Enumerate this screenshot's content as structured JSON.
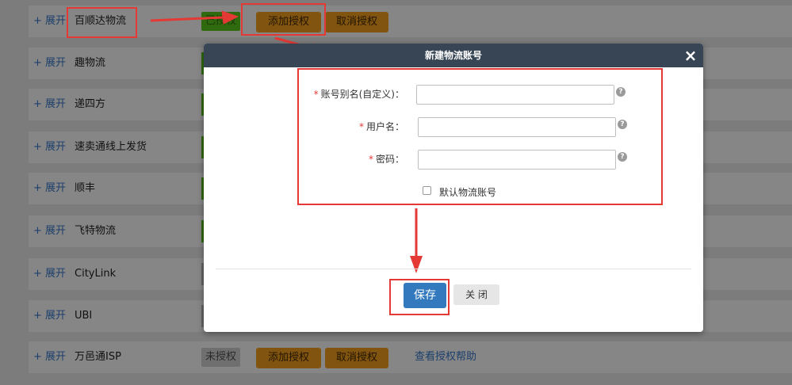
{
  "list": {
    "expand_label": "+ 展开",
    "add_auth_label": "添加授权",
    "cancel_auth_label": "取消授权",
    "help_link": "查看授权帮助",
    "status_authorized": "已授权",
    "status_unauthorized": "未授权",
    "carriers": [
      "百顺达物流",
      "趣物流",
      "递四方",
      "速卖通线上发货",
      "顺丰",
      "飞特物流",
      "CityLink",
      "UBI",
      "万邑通ISP"
    ]
  },
  "modal": {
    "title": "新建物流账号",
    "close_icon": "×",
    "required_mark": "*",
    "alias_label": "账号别名(自定义)：",
    "alias_value": "",
    "username_label": "用户名：",
    "username_value": "",
    "password_label": "密码：",
    "password_value": "",
    "help_icon": "?",
    "default_label": "默认物流账号",
    "save_label": "保存",
    "close_label": "关 闭"
  },
  "colors": {
    "header_bg": "#374555",
    "save_bg": "#3279bd",
    "orange_btn": "#e0a33a",
    "authorized_green": "#5cb82a",
    "highlight_red": "#e53935"
  }
}
